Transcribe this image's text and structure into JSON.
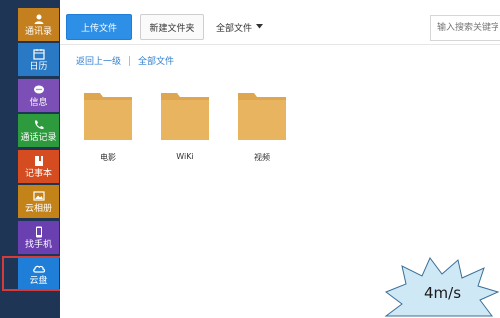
{
  "sidebar": {
    "items": [
      {
        "label": "通讯录",
        "icon": "contacts-icon",
        "color": "#c47f1e"
      },
      {
        "label": "日历",
        "icon": "calendar-icon",
        "color": "#2979c5"
      },
      {
        "label": "信息",
        "icon": "message-icon",
        "color": "#7b4fb6"
      },
      {
        "label": "通话记录",
        "icon": "phone-icon",
        "color": "#2e9a3e"
      },
      {
        "label": "记事本",
        "icon": "notebook-icon",
        "color": "#d44c1f"
      },
      {
        "label": "云相册",
        "icon": "photo-icon",
        "color": "#c48318"
      },
      {
        "label": "找手机",
        "icon": "find-phone-icon",
        "color": "#6a3fb0"
      },
      {
        "label": "云盘",
        "icon": "cloud-icon",
        "color": "#1f7fd8"
      }
    ]
  },
  "toolbar": {
    "upload_label": "上传文件",
    "new_folder_label": "新建文件夹",
    "filter_label": "全部文件",
    "search_placeholder": "输入搜索关键字"
  },
  "breadcrumb": {
    "back": "返回上一级",
    "current": "全部文件"
  },
  "folders": [
    {
      "name": "电影"
    },
    {
      "name": "WiKi"
    },
    {
      "name": "视频"
    }
  ],
  "overlay": {
    "speed_text": "4m/s"
  },
  "colors": {
    "accent": "#2e8fe6",
    "folder": "#e9b45f",
    "selection_outline": "#d43b3b"
  }
}
